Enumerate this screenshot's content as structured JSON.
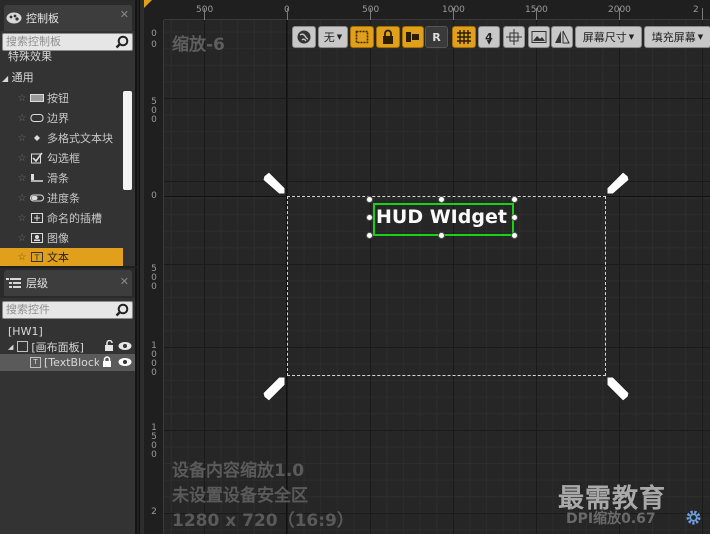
{
  "palette": {
    "tab_title": "控制板",
    "search_placeholder": "搜索控制板",
    "partial_category": "特殊效果",
    "category": "通用",
    "items": [
      {
        "label": "按钮",
        "icon": "button-icon"
      },
      {
        "label": "边界",
        "icon": "border-icon"
      },
      {
        "label": "多格式文本块",
        "icon": "rich-text-icon"
      },
      {
        "label": "勾选框",
        "icon": "checkbox-icon"
      },
      {
        "label": "滑条",
        "icon": "slider-icon"
      },
      {
        "label": "进度条",
        "icon": "progress-bar-icon"
      },
      {
        "label": "命名的插槽",
        "icon": "named-slot-icon"
      },
      {
        "label": "图像",
        "icon": "image-icon"
      },
      {
        "label": "文本",
        "icon": "text-icon"
      }
    ]
  },
  "hierarchy": {
    "tab_title": "层级",
    "search_placeholder": "搜索控件",
    "root": "[HW1]",
    "canvas_label": "[画布面板]",
    "textblock_label": "[TextBlock"
  },
  "designer": {
    "zoom_label": "缩放-6",
    "ruler_top": [
      "500",
      "0",
      "500",
      "1000",
      "1500",
      "2000",
      "2"
    ],
    "ruler_left": [
      "0",
      "0",
      "500",
      "0",
      "500",
      "1000",
      "1500",
      "2"
    ],
    "toolbar": {
      "none_label": "无",
      "r_label": "R",
      "snap_value": "4",
      "screen_size_label": "屏幕尺寸",
      "fill_screen_label": "填充屏幕"
    },
    "widget_text": "HUD WIdget",
    "info_lines": [
      "设备内容缩放1.0",
      "未设置设备安全区",
      "1280 x 720（16:9）"
    ],
    "dpi_label": "DPI缩放0.67",
    "watermark": "最需教育"
  },
  "colors": {
    "accent": "#e0a01b",
    "selection_green": "#1ad11a"
  }
}
